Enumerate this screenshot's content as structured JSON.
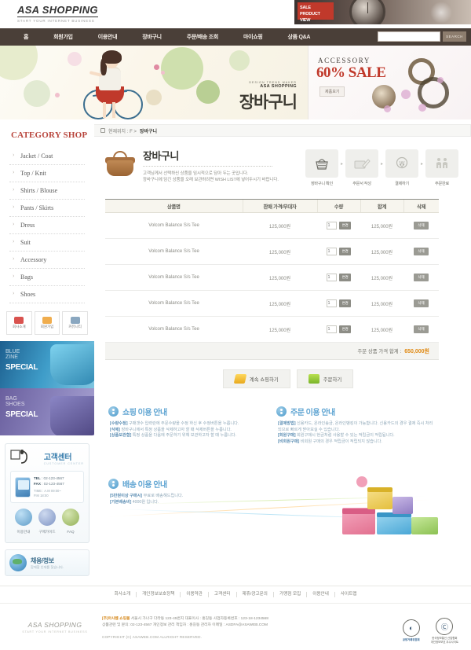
{
  "brand": {
    "name": "ASA SHOPPING",
    "tagline": "START YOUR INTERNET BUSINESS"
  },
  "top_promo": {
    "badge_line1": "SALE PRODUCT",
    "badge_line2": "VIEW"
  },
  "nav": {
    "items": [
      {
        "label": "홈"
      },
      {
        "label": "회원가입"
      },
      {
        "label": "이용안내"
      },
      {
        "label": "장바구니"
      },
      {
        "label": "주문/배송 조회"
      },
      {
        "label": "마이쇼핑"
      },
      {
        "label": "상품 Q&A"
      }
    ],
    "search_value": "",
    "search_placeholder": "",
    "search_button": "SEARCH"
  },
  "hero": {
    "kicker": "DESIGN TREND MAKER",
    "brand": "ASA SHOPPING",
    "title": "장바구니"
  },
  "side_banner": {
    "label": "ACCESSORY",
    "sale": "60% SALE",
    "button": "제품보기"
  },
  "sidebar": {
    "category_title": "CATEGORY SHOP",
    "categories": [
      {
        "label": "Jacket / Coat"
      },
      {
        "label": "Top / Knit"
      },
      {
        "label": "Shirts / Blouse"
      },
      {
        "label": "Pants / Skirts"
      },
      {
        "label": "Dress"
      },
      {
        "label": "Suit"
      },
      {
        "label": "Accessory"
      },
      {
        "label": "Bags"
      },
      {
        "label": "Shoes"
      }
    ],
    "quick_buttons": [
      {
        "label": "회사소개",
        "color": "#d9534f"
      },
      {
        "label": "회원가입",
        "color": "#f0ad4e"
      },
      {
        "label": "커뮤니티",
        "color": "#8aa7c0"
      }
    ],
    "promo_banners": [
      {
        "line1": "BLUE",
        "line2": "ZINE",
        "line3": "SPECIAL"
      },
      {
        "line1": "BAG",
        "line2": "SHOES",
        "line3": "SPECIAL"
      }
    ],
    "customer_center": {
      "title": "고객센터",
      "subtitle": "CUSTOMER CENTER",
      "tel_label": "TEL",
      "tel": "02-123-4567",
      "fax_label": "FAX",
      "fax": "02-123-4567",
      "time_label": "TIME",
      "time1": "A.M 09:00~",
      "time2": "P.M 18:00",
      "icons": [
        {
          "label": "이용안내",
          "color": "#7fb7dd"
        },
        {
          "label": "구매가이드",
          "color": "#9fb8d6"
        },
        {
          "label": "FAQ",
          "color": "#b8cf85"
        }
      ]
    },
    "job_box": {
      "title": "채용/정보",
      "subtitle": "함께할 인재를 찾습니다."
    }
  },
  "breadcrumb": {
    "prefix": "현재위치 : F >",
    "current": "장바구니"
  },
  "cart": {
    "title": "장바구니",
    "desc_line1": "고객님께서 선택하신 상품을 임시적으로 담아 두는 곳입니다.",
    "desc_line2": "장바구니에 담긴 상품을 오래 보관하려면 WISH LIST에 넣어두시기 바랍니다.",
    "steps": [
      {
        "label": "장바구니 확인",
        "icon": "basket-icon"
      },
      {
        "label": "주문서 작성",
        "icon": "order-form-icon"
      },
      {
        "label": "결제하기",
        "icon": "payment-icon"
      },
      {
        "label": "주문완료",
        "icon": "complete-icon"
      }
    ],
    "step_separator": "▸",
    "columns": [
      "상품명",
      "판매 가격/무대자",
      "수량",
      "합계",
      "삭제"
    ],
    "rows": [
      {
        "name": "Volcom Balance S/s Tee",
        "price": "125,000원",
        "qty": "1",
        "change": "변경",
        "subtotal": "125,000원",
        "delete": "삭제"
      },
      {
        "name": "Volcom Balance S/s Tee",
        "price": "125,000원",
        "qty": "1",
        "change": "변경",
        "subtotal": "125,000원",
        "delete": "삭제"
      },
      {
        "name": "Volcom Balance S/s Tee",
        "price": "125,000원",
        "qty": "1",
        "change": "변경",
        "subtotal": "125,000원",
        "delete": "삭제"
      },
      {
        "name": "Volcom Balance S/s Tee",
        "price": "125,000원",
        "qty": "1",
        "change": "변경",
        "subtotal": "125,000원",
        "delete": "삭제"
      },
      {
        "name": "Volcom Balance S/s Tee",
        "price": "125,000원",
        "qty": "1",
        "change": "변경",
        "subtotal": "125,000원",
        "delete": "삭제"
      }
    ],
    "total_label": "주문 상품 가격 합계 :",
    "total_value": "650,000원",
    "continue_button": "계속 쇼핑하기",
    "order_button": "주문하기"
  },
  "guides": {
    "shopping": {
      "title": "쇼핑 이용 안내",
      "items": [
        {
          "tag": "[수량수정]",
          "text": " 구매갯수 입력란에 주문수량을 수정 하신 후 수정버튼을 누릅니다."
        },
        {
          "tag": "[삭제]",
          "text": " 장바구니에서 특정 상품을 삭제하고자 할 때 삭제버튼을 누릅니다."
        },
        {
          "tag": "[상품보관함]",
          "text": " 특정 상품을 다음에 주문하기 위해 보관하고자 할 때 누릅니다."
        }
      ]
    },
    "order": {
      "title": "주문 이용 안내",
      "items": [
        {
          "tag": "[결제방법]",
          "text": " 신용카드, 온라인송금, 온라인뱅킹이 가능합니다. 신용카드의 경우 결제 즉시 처리되므로 빠르게 받아보실 수 있습니다."
        },
        {
          "tag": "[회원구매]",
          "text": " 회원구매시 현금처럼 사용할 수 있는 적립금이 적립됩니다."
        },
        {
          "tag": "[비회원구매]",
          "text": " 비회원 구매의 경우 적립금이 적립되지 않습니다."
        }
      ]
    },
    "delivery": {
      "title": "배송 이용 안내",
      "items": [
        {
          "tag": "[5만원이상 구매시]",
          "text": " 무료로 배송해드립니다."
        },
        {
          "tag": "[기본배송비]",
          "text": " 4000원 입니다."
        }
      ]
    }
  },
  "footer": {
    "links": [
      {
        "label": "회사소개"
      },
      {
        "label": "개인정보보호정책"
      },
      {
        "label": "이용약관"
      },
      {
        "label": "고객센터"
      },
      {
        "label": "제휴/광고문의"
      },
      {
        "label": "가맹점 모집"
      },
      {
        "label": "이용안내"
      },
      {
        "label": "사이트맵"
      }
    ],
    "logo": "ASA SHOPPING",
    "logo_sub": "START YOUR INTERNET BUSINESS",
    "company": "[주]아사웹 쇼핑몰",
    "info_line1": " 서울시 가나구 다라동 123-45번지  대표이사 : 홍길동  사업자등록번호 : 123-18-1234568",
    "info_line2": "상품관련 및 문의: 02-123-4567  개인정보 관리 책임자 : 홍길동  관리자 이메일 : ASDFA@ASAWEB.COM",
    "copyright": "COPYRIGHT (C) ASAWEB.COM  ALLRIGHT RESERVED.",
    "marks": [
      {
        "line1": "공정거래위원회",
        "line2": "FAIR TRADE COMMISSION"
      },
      {
        "line1": "한국정보통신 산업협회",
        "line2": "개인정보보호 우수사이트"
      }
    ]
  }
}
